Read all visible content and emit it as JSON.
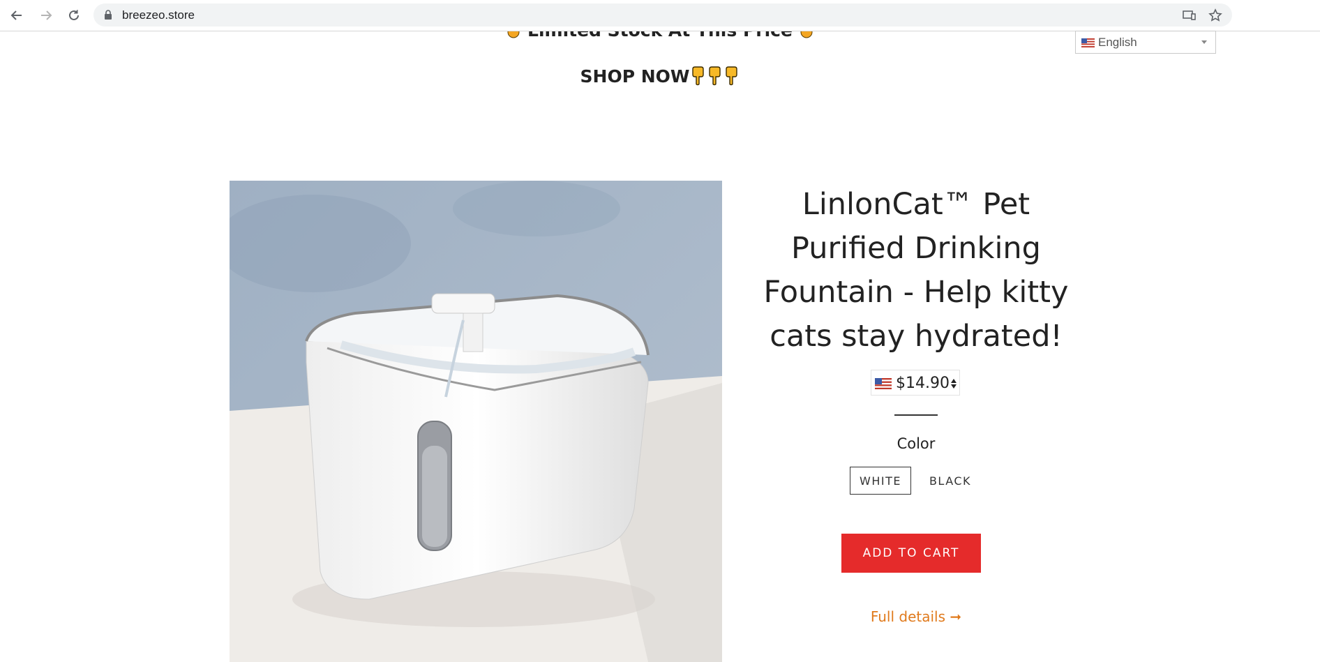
{
  "browser": {
    "url": "breezeo.store"
  },
  "page": {
    "announcement_top": "Limited Stock At This Price",
    "shop_now": "SHOP NOW"
  },
  "language": {
    "selected": "English"
  },
  "product": {
    "title": "LinlonCat™ Pet Purified Drinking Fountain - Help kitty cats stay hydrated!",
    "price": "$14.90",
    "color_label": "Color",
    "colors": [
      "WHITE",
      "BLACK"
    ],
    "selected_color": "WHITE",
    "add_to_cart": "ADD TO CART",
    "full_details": "Full details ➞"
  },
  "colors": {
    "accent_red": "#e52b2b",
    "link_orange": "#e07a1c",
    "image_bg_blue": "#a4b4c6"
  }
}
